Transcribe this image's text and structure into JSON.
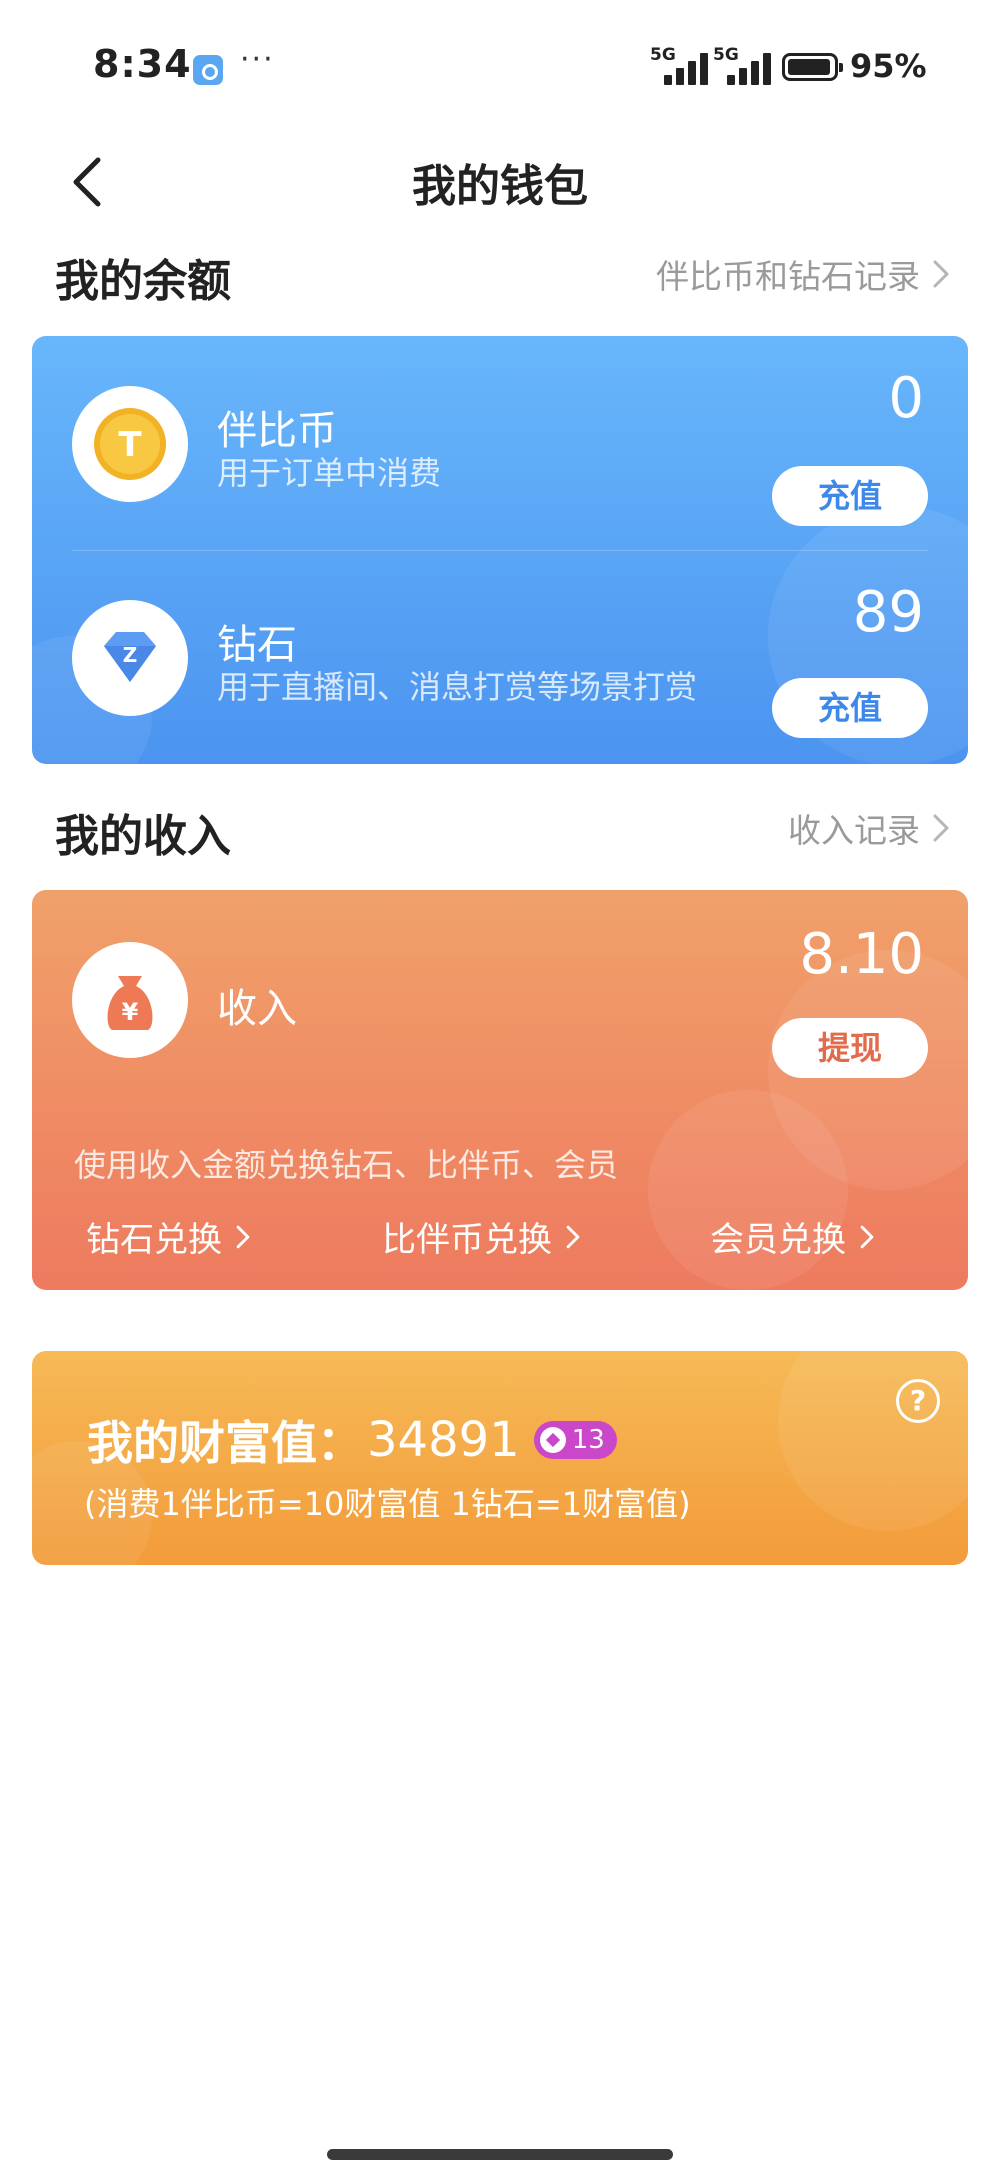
{
  "status_bar": {
    "time": "8:34",
    "more": "···",
    "signal1_label": "5G",
    "signal2_label": "5G",
    "battery": "95%"
  },
  "header": {
    "title": "我的钱包"
  },
  "balance": {
    "title": "我的余额",
    "link": "伴比币和钻石记录",
    "items": [
      {
        "name": "伴比币",
        "desc": "用于订单中消费",
        "value": "0",
        "button": "充值",
        "icon": "coin-icon",
        "icon_glyph": "T"
      },
      {
        "name": "钻石",
        "desc": "用于直播间、消息打赏等场景打赏",
        "value": "89",
        "button": "充值",
        "icon": "diamond-icon",
        "icon_glyph": "Z"
      }
    ]
  },
  "income": {
    "title": "我的收入",
    "link": "收入记录",
    "name": "收入",
    "value": "8.10",
    "button": "提现",
    "icon_glyph": "¥",
    "exchange_hint": "使用收入金额兑换钻石、比伴币、会员",
    "exchanges": [
      "钻石兑换",
      "比伴币兑换",
      "会员兑换"
    ]
  },
  "wealth": {
    "label": "我的财富值：",
    "value": "34891",
    "level": "13",
    "note": "(消费1伴比币=10财富值 1钻石=1财富值)",
    "help": "?"
  },
  "colors": {
    "blue_card": "#4b94f0",
    "orange_card": "#ee7a5f",
    "gold_card": "#f39b3a",
    "badge": "#c947c8"
  }
}
